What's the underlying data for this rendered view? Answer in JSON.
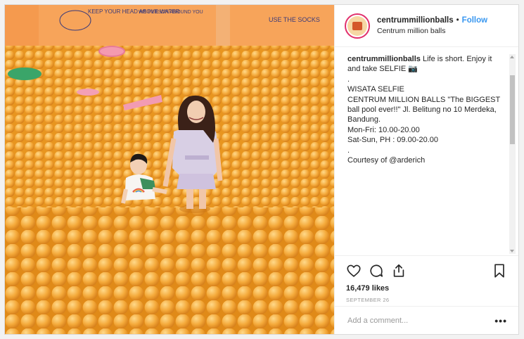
{
  "post": {
    "username": "centrummillionballs",
    "dot": "•",
    "follow_label": "Follow",
    "location": "Centrum million balls"
  },
  "caption": {
    "username": "centrummillionballs",
    "lines": [
      " Life is short. Enjoy it and take SELFIE 📷",
      ".",
      "WISATA SELFIE",
      "CENTRUM MILLION BALLS \"The BIGGEST ball pool ever!!\" Jl. Belitung no 10 Merdeka, Bandung.",
      "Mon-Fri: 10.00-20.00",
      "Sat-Sun, PH : 09.00-20.00",
      ".",
      "Courtesy of @arderich"
    ]
  },
  "photo": {
    "wall_texts": [
      "KEEP YOUR HEAD ABOVE WATER",
      "WE PERSON AROUND YOU",
      "USE THE SOCKS"
    ]
  },
  "actions": {
    "icons": [
      "heart-icon",
      "comment-icon",
      "share-icon",
      "bookmark-icon"
    ]
  },
  "likes": "16,479 likes",
  "date": "SEPTEMBER 26",
  "add_comment": {
    "placeholder": "Add a comment...",
    "more": "•••"
  },
  "colors": {
    "follow": "#3897f0",
    "balls": "#f4a93a",
    "wall": "#f7a45a"
  }
}
